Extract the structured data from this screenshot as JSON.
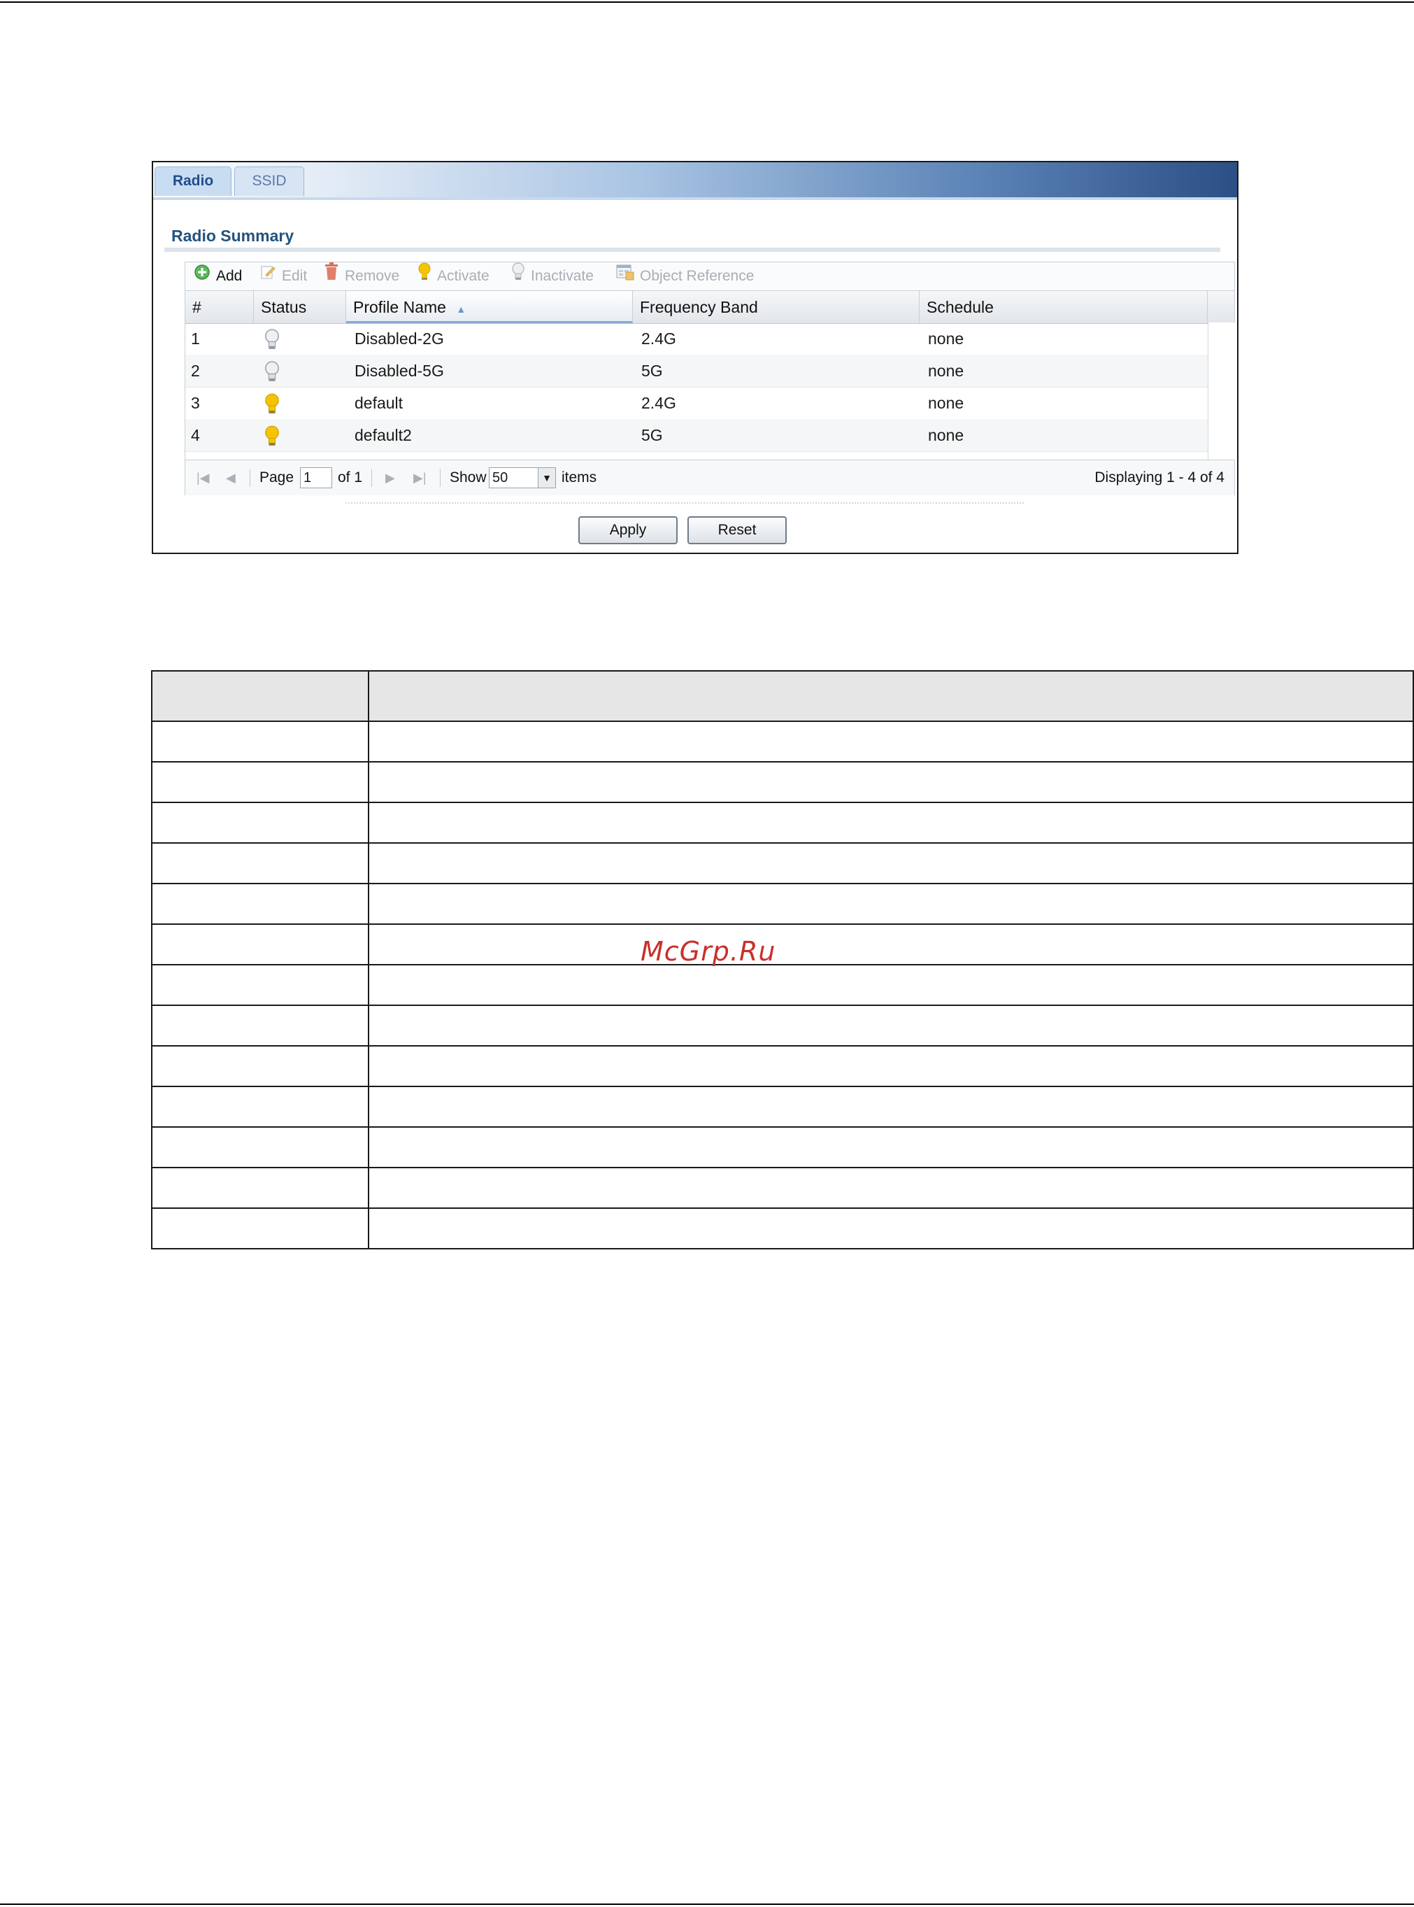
{
  "tabs": [
    {
      "label": "Radio",
      "active": true
    },
    {
      "label": "SSID",
      "active": false
    }
  ],
  "section_title": "Radio Summary",
  "toolbar": {
    "add": "Add",
    "edit": "Edit",
    "remove": "Remove",
    "activate": "Activate",
    "inactivate": "Inactivate",
    "object_reference": "Object Reference"
  },
  "columns": [
    "#",
    "Status",
    "Profile Name",
    "Frequency Band",
    "Schedule"
  ],
  "sort_column": "Profile Name",
  "rows": [
    {
      "num": "1",
      "status": "inactive",
      "profile": "Disabled-2G",
      "band": "2.4G",
      "schedule": "none"
    },
    {
      "num": "2",
      "status": "inactive",
      "profile": "Disabled-5G",
      "band": "5G",
      "schedule": "none"
    },
    {
      "num": "3",
      "status": "active",
      "profile": "default",
      "band": "2.4G",
      "schedule": "none"
    },
    {
      "num": "4",
      "status": "active",
      "profile": "default2",
      "band": "5G",
      "schedule": "none"
    }
  ],
  "pager": {
    "page_label": "Page",
    "page_value": "1",
    "of_label": "of 1",
    "show_label": "Show",
    "show_value": "50",
    "items_label": "items",
    "displaying": "Displaying 1 - 4 of 4"
  },
  "buttons": {
    "apply": "Apply",
    "reset": "Reset"
  },
  "watermark": "McGrp.Ru",
  "colors": {
    "active_bulb": "#f5c400",
    "inactive_bulb": "#c8ccd1",
    "title": "#24527f"
  }
}
